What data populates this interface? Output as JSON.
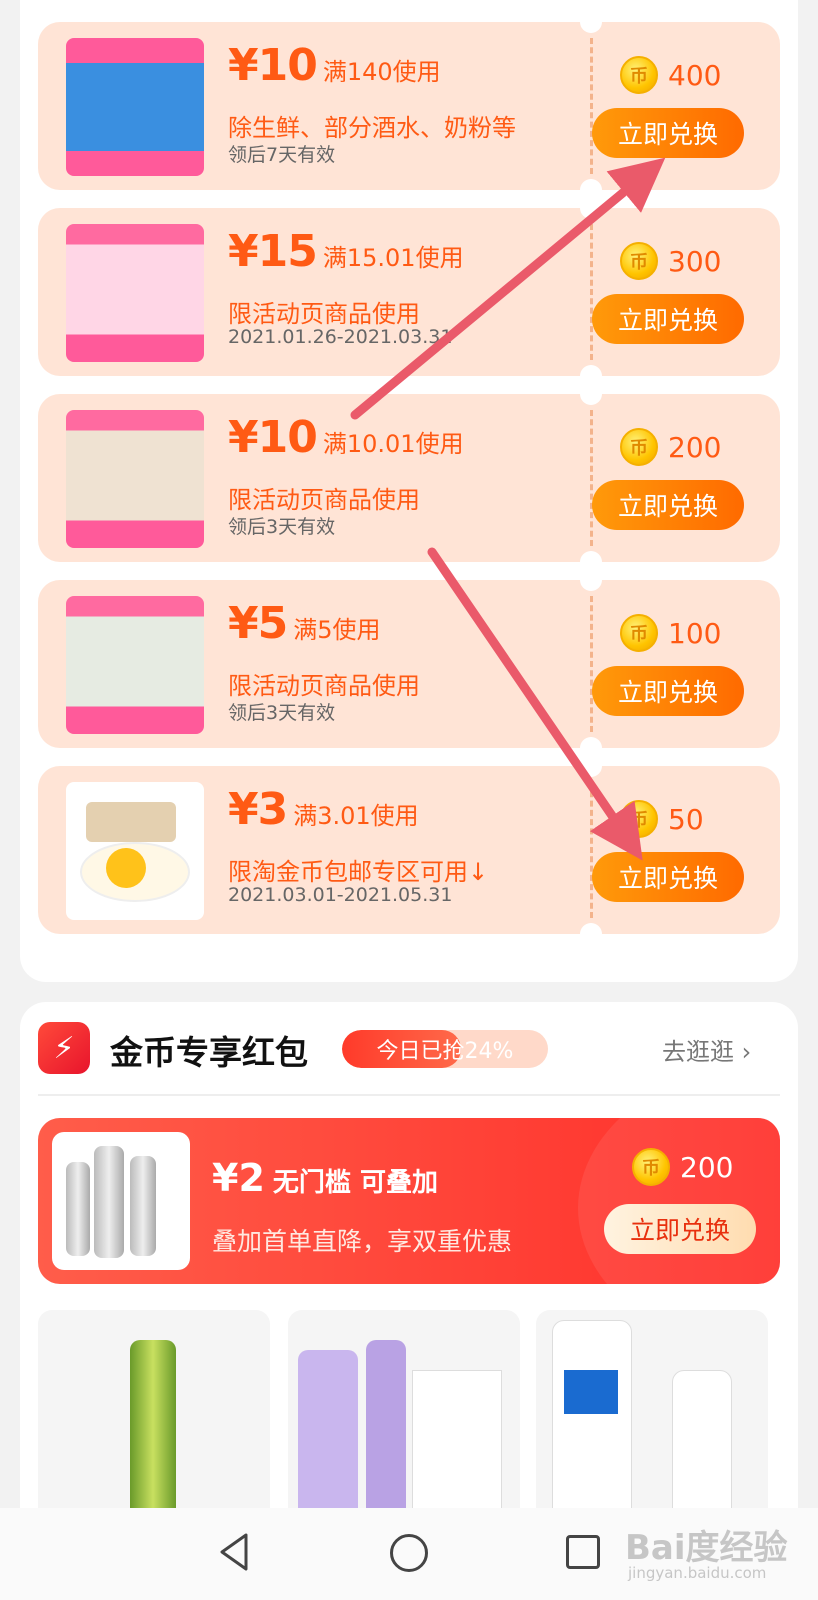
{
  "coupons": [
    {
      "yen": "¥10",
      "condition": "满140使用",
      "desc": "除生鲜、部分酒水、奶粉等",
      "valid": "领后7天有效",
      "coins": "400",
      "button": "立即兑换"
    },
    {
      "yen": "¥15",
      "condition": "满15.01使用",
      "desc": "限活动页商品使用",
      "valid": "2021.01.26-2021.03.31",
      "coins": "300",
      "button": "立即兑换"
    },
    {
      "yen": "¥10",
      "condition": "满10.01使用",
      "desc": "限活动页商品使用",
      "valid": "领后3天有效",
      "coins": "200",
      "button": "立即兑换"
    },
    {
      "yen": "¥5",
      "condition": "满5使用",
      "desc": "限活动页商品使用",
      "valid": "领后3天有效",
      "coins": "100",
      "button": "立即兑换"
    },
    {
      "yen": "¥3",
      "condition": "满3.01使用",
      "desc": "限淘金币包邮专区可用↓",
      "valid": "2021.03.01-2021.05.31",
      "coins": "50",
      "button": "立即兑换"
    }
  ],
  "section": {
    "title": "金币专享红包",
    "progress_label": "今日已抢24%",
    "progress_fraction": 0.24,
    "more_label": "去逛逛"
  },
  "red_packet": {
    "yen": "¥2",
    "condition": "无门槛 可叠加",
    "desc": "叠加首单直降，享双重优惠",
    "coins": "200",
    "button": "立即兑换"
  },
  "coin_glyph": "币",
  "icons": {
    "bolt": "⚡",
    "chevron": "›"
  },
  "watermark": {
    "main": "Bai度经验",
    "sub": "jingyan.baidu.com"
  },
  "colors": {
    "accent": "#ff5a14",
    "button": "#ff7a00",
    "red": "#ff3a2a",
    "arrow": "#ea5a6a"
  }
}
